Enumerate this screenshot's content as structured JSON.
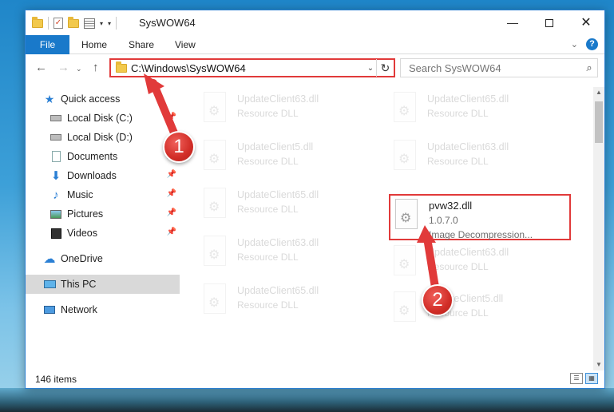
{
  "window": {
    "title": "SysWOW64"
  },
  "ribbon": {
    "tabs": [
      "File",
      "Home",
      "Share",
      "View"
    ]
  },
  "navigation": {
    "address": "C:\\Windows\\SysWOW64",
    "search_placeholder": "Search SysWOW64"
  },
  "sidebar": {
    "items": [
      {
        "label": "Quick access",
        "icon": "star-icon"
      },
      {
        "label": "Local Disk (C:)",
        "icon": "drive-icon",
        "pinned": true
      },
      {
        "label": "Local Disk (D:)",
        "icon": "drive-icon"
      },
      {
        "label": "Documents",
        "icon": "documents-icon",
        "pinned": true
      },
      {
        "label": "Downloads",
        "icon": "download-icon",
        "pinned": true
      },
      {
        "label": "Music",
        "icon": "music-icon",
        "pinned": true
      },
      {
        "label": "Pictures",
        "icon": "pictures-icon",
        "pinned": true
      },
      {
        "label": "Videos",
        "icon": "videos-icon",
        "pinned": true
      },
      {
        "label": "OneDrive",
        "icon": "cloud-icon"
      },
      {
        "label": "This PC",
        "icon": "computer-icon",
        "selected": true
      },
      {
        "label": "Network",
        "icon": "network-icon"
      }
    ]
  },
  "files": {
    "background_tiles": [
      {
        "name": "UpdateClient63.dll",
        "desc": "Resource DLL"
      },
      {
        "name": "UpdateClient65.dll",
        "desc": "Resource DLL"
      },
      {
        "name": "UpdateClient5.dll",
        "desc": "Resource DLL"
      },
      {
        "name": "UpdateClient63.dll",
        "desc": "Resource DLL"
      },
      {
        "name": "UpdateClient65.dll",
        "desc": "Resource DLL"
      },
      {
        "name": "UpdateClient63.dll",
        "desc": "Resource DLL"
      },
      {
        "name": "UpdateClient63.dll",
        "desc": "Resource DLL"
      },
      {
        "name": "UpdateClient65.dll",
        "desc": "Resource DLL"
      },
      {
        "name": "UpdateClient5.dll",
        "desc": "Resource DLL"
      }
    ],
    "highlighted": {
      "name": "pvw32.dll",
      "version": "1.0.7.0",
      "desc": "Image Decompression..."
    }
  },
  "status": {
    "item_count": "146 items"
  },
  "annotations": {
    "step1": "1",
    "step2": "2",
    "color": "#e13a3a"
  }
}
